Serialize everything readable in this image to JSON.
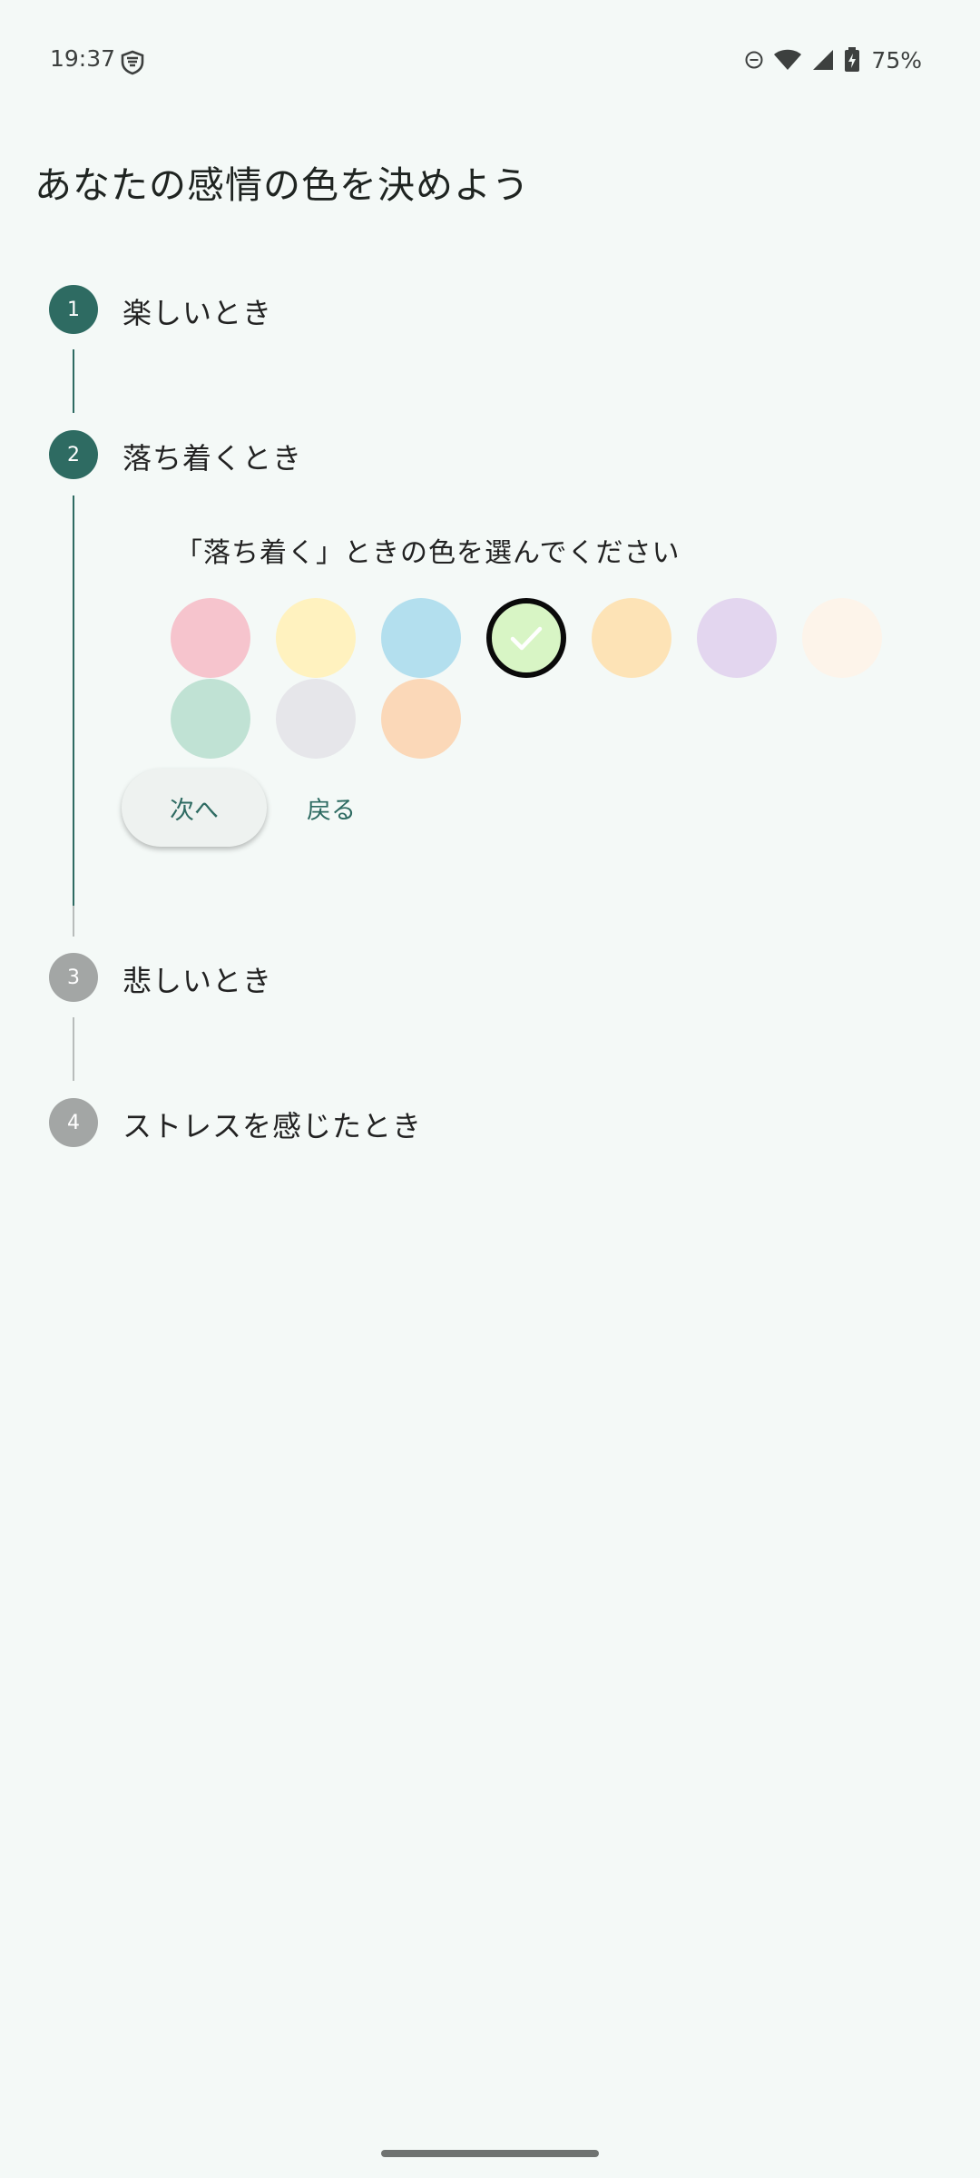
{
  "status_bar": {
    "time": "19:37",
    "battery_percent": "75%",
    "icons": [
      "vpn-shield-icon",
      "do-not-disturb-icon",
      "wifi-icon",
      "signal-icon",
      "battery-charging-icon"
    ]
  },
  "page": {
    "title": "あなたの感情の色を決めよう"
  },
  "steps": [
    {
      "number": "1",
      "label": "楽しいとき",
      "state": "completed"
    },
    {
      "number": "2",
      "label": "落ち着くとき",
      "state": "active"
    },
    {
      "number": "3",
      "label": "悲しいとき",
      "state": "inactive"
    },
    {
      "number": "4",
      "label": "ストレスを感じたとき",
      "state": "inactive"
    }
  ],
  "active_step": {
    "prompt": "「落ち着く」ときの色を選んでください",
    "colors": [
      {
        "name": "pink",
        "hex": "#f6c4cd",
        "selected": false
      },
      {
        "name": "yellow",
        "hex": "#fff2bf",
        "selected": false
      },
      {
        "name": "light-blue",
        "hex": "#b3dfee",
        "selected": false
      },
      {
        "name": "light-green",
        "hex": "#d8f5c5",
        "selected": true
      },
      {
        "name": "light-orange",
        "hex": "#fde3b6",
        "selected": false
      },
      {
        "name": "lavender",
        "hex": "#e3d6ef",
        "selected": false
      },
      {
        "name": "cream",
        "hex": "#fdf4ea",
        "selected": false
      },
      {
        "name": "mint",
        "hex": "#c0e2d4",
        "selected": false
      },
      {
        "name": "light-gray",
        "hex": "#e6e6ea",
        "selected": false
      },
      {
        "name": "peach",
        "hex": "#fbd8b8",
        "selected": false
      }
    ],
    "next_label": "次へ",
    "back_label": "戻る"
  },
  "theme": {
    "accent": "#2e6b62",
    "inactive": "#a3a6a5",
    "background": "#f4f9f7"
  }
}
